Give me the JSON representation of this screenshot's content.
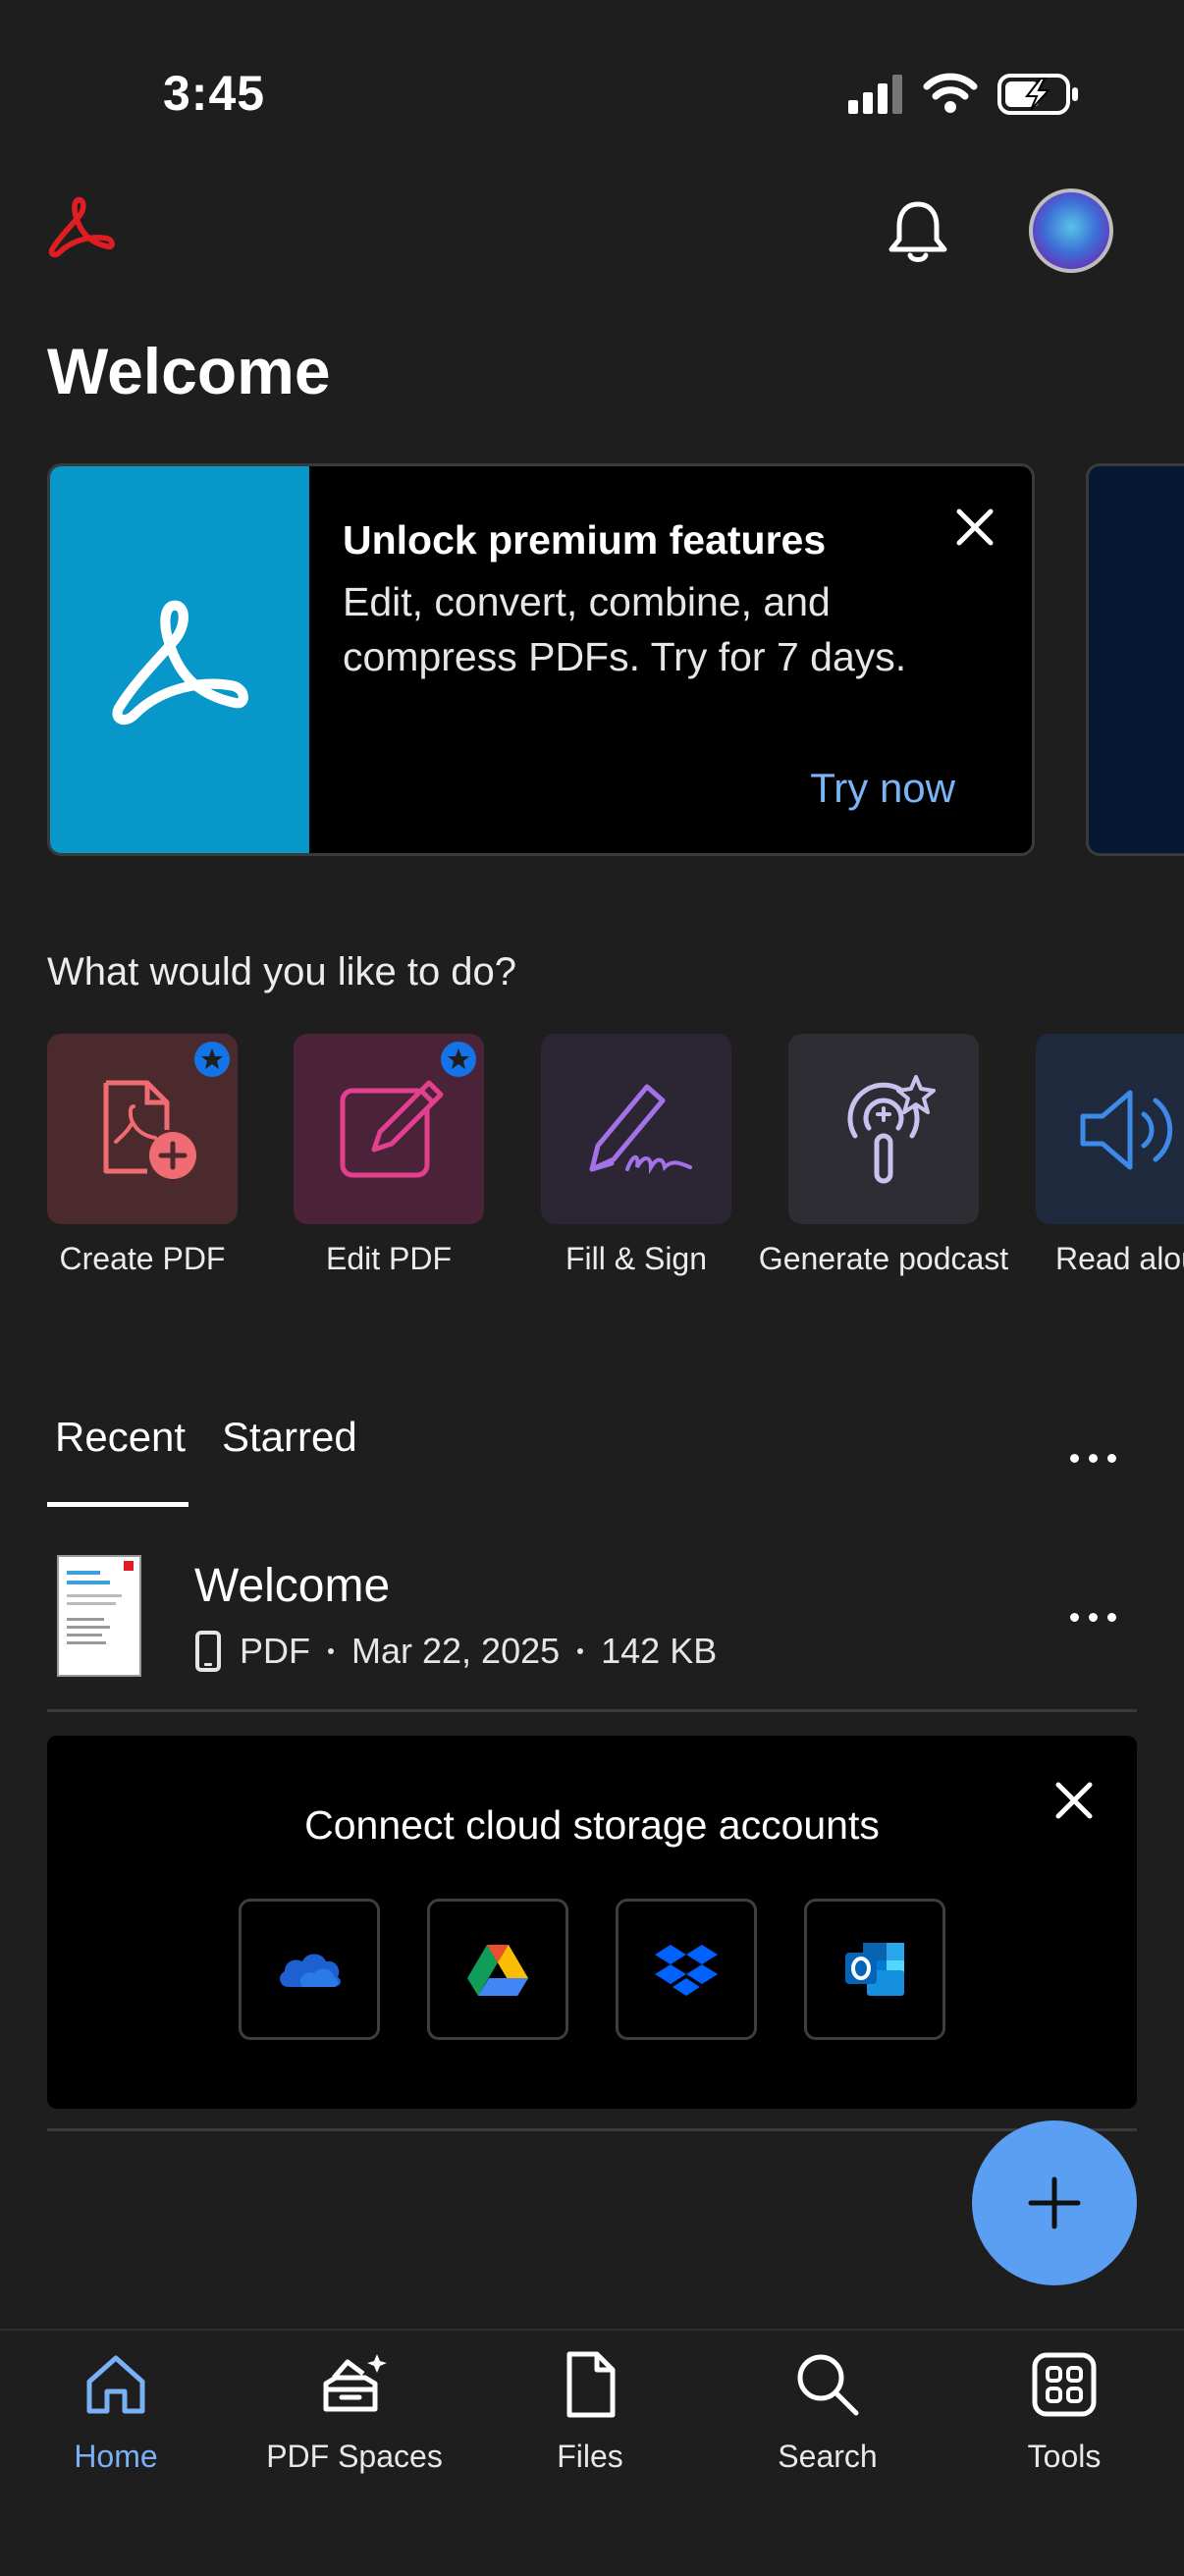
{
  "status_bar": {
    "time": "3:45"
  },
  "header": {
    "title": "Welcome"
  },
  "promo": {
    "title": "Unlock premium features",
    "description": "Edit, convert, combine, and compress PDFs. Try for 7 days.",
    "cta": "Try now"
  },
  "quick_actions": {
    "heading": "What would you like to do?",
    "items": [
      {
        "label": "Create PDF"
      },
      {
        "label": "Edit PDF"
      },
      {
        "label": "Fill & Sign"
      },
      {
        "label": "Generate podcast"
      },
      {
        "label": "Read alou"
      }
    ]
  },
  "tabs": [
    {
      "label": "Recent"
    },
    {
      "label": "Starred"
    }
  ],
  "recent": [
    {
      "name": "Welcome",
      "type": "PDF",
      "date": "Mar 22, 2025",
      "size": "142 KB"
    }
  ],
  "cloud": {
    "title": "Connect cloud storage accounts"
  },
  "bottom_nav": [
    {
      "label": "Home"
    },
    {
      "label": "PDF Spaces"
    },
    {
      "label": "Files"
    },
    {
      "label": "Search"
    },
    {
      "label": "Tools"
    }
  ],
  "colors": {
    "accent": "#5a9ff2",
    "brand_red": "#e01d23",
    "promo_blue": "#0797c8",
    "active_nav": "#7ab0f5"
  }
}
